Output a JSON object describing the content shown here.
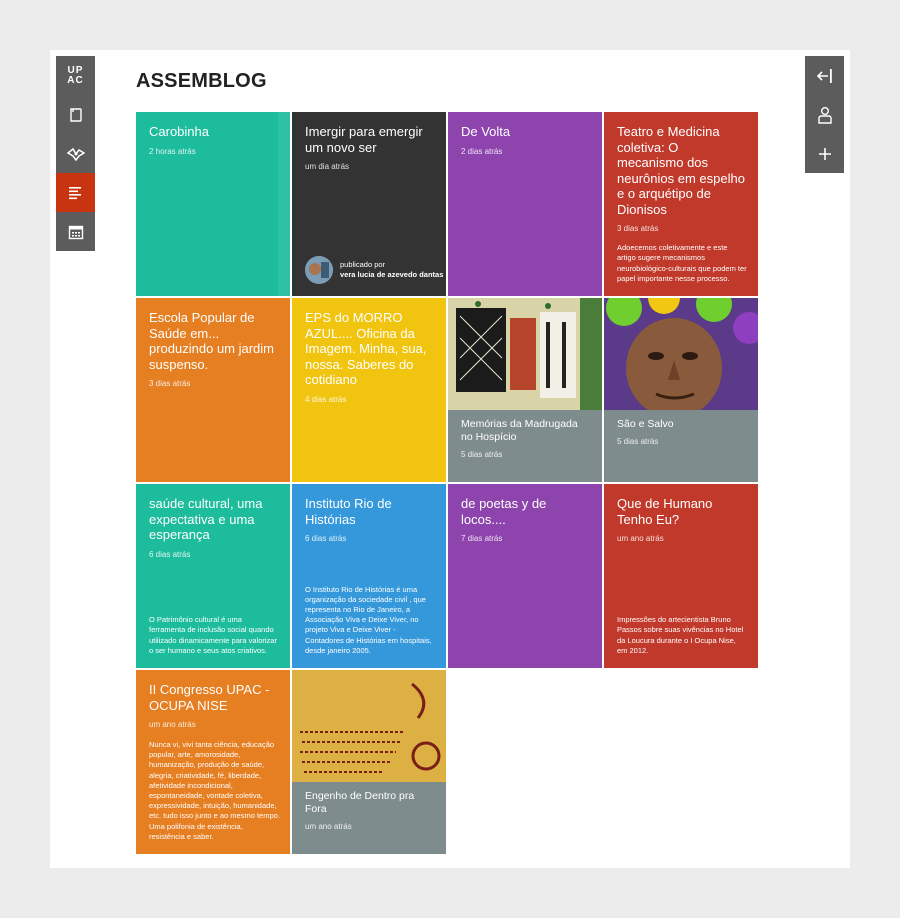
{
  "app_title": "ASSEMBLOG",
  "logo": {
    "line1": "UP",
    "line2": "AC"
  },
  "left_nav": [
    {
      "name": "notebook-icon",
      "active": false
    },
    {
      "name": "network-icon",
      "active": false
    },
    {
      "name": "text-lines-icon",
      "active": true
    },
    {
      "name": "calendar-icon",
      "active": false
    }
  ],
  "right_nav": [
    "collapse-left-icon",
    "user-icon",
    "plus-icon"
  ],
  "tiles": [
    {
      "title": "Carobinha",
      "date": "2 horas atrás",
      "color": "#1dbc9c"
    },
    {
      "title": "Imergir para emergir um novo ser",
      "date": "um dia atrás",
      "color": "#333333",
      "author_label": "publicado por",
      "author_name": "vera lucia de azevedo dantas"
    },
    {
      "title": "De Volta",
      "date": "2 dias atrás",
      "color": "#8e44ad"
    },
    {
      "title": "Teatro e Medicina coletiva: O mecanismo dos neurônios em espelho e o arquétipo de Dionisos",
      "date": "3 dias atrás",
      "color": "#c0392b",
      "excerpt": "Adoecemos coletivamente e este artigo sugere mecanismos neurobiológico-culturais que podem ter papel importante nesse processo."
    },
    {
      "title": "Escola Popular de Saúde em... produzindo um jardim suspenso.",
      "date": "3 dias atrás",
      "color": "#e67e22"
    },
    {
      "title": "EPS do MORRO AZUL.... Oficina da Imagem. Minha, sua, nossa. Saberes do cotidiano",
      "date": "4 dias atrás",
      "color": "#f1c40f"
    },
    {
      "title": "Memórias da Madrugada no Hospício",
      "date": "5 dias atrás",
      "color": "#7f8c8d"
    },
    {
      "title": "São e Salvo",
      "date": "5 dias atrás",
      "color": "#7f8c8d"
    },
    {
      "title": "saúde cultural, uma expectativa e uma esperança",
      "date": "6 dias atrás",
      "color": "#1dbc9c",
      "excerpt": "O Patrimônio cultural é uma ferramenta de inclusão social quando utilizado dinamicamente para valorizar o ser humano e seus atos criativos."
    },
    {
      "title": "Instituto Rio de Histórias",
      "date": "6 dias atrás",
      "color": "#3498db",
      "excerpt": "O Instituto Rio de Histórias é uma organização da sociedade civil , que representa no Rio de Janeiro, a Associação Viva e Deixe Viver, no projeto Viva e Deixe Viver - Contadores de Histórias em hospitais, desde janeiro 2005."
    },
    {
      "title": "de poetas y de locos....",
      "date": "7 dias atrás",
      "color": "#8e44ad"
    },
    {
      "title": "Que de Humano Tenho Eu?",
      "date": "um ano atrás",
      "color": "#c0392b",
      "excerpt": "Impressões do artecientista Bruno Passos sobre suas vivências no Hotel da Loucura durante o I Ocupa Nise, em 2012."
    },
    {
      "title": "II Congresso UPAC - OCUPA NISE",
      "date": "um ano atrás",
      "color": "#e67e22",
      "excerpt": "Nunca vi, vivi tanta ciência, educação popular, arte, amorosidade, humanização, produção de saúde, alegria, criatividade, fé, liberdade, afetividade incondicional, espontaneidade, vontade coletiva, expressividade, intuição, humanidade, etc. tudo isso junto e ao mesmo tempo. Uma polifonia de existência, resistência e saber."
    },
    {
      "title": "Engenho de Dentro pra Fora",
      "date": "um ano atrás",
      "color": "#7f8c8d"
    }
  ]
}
